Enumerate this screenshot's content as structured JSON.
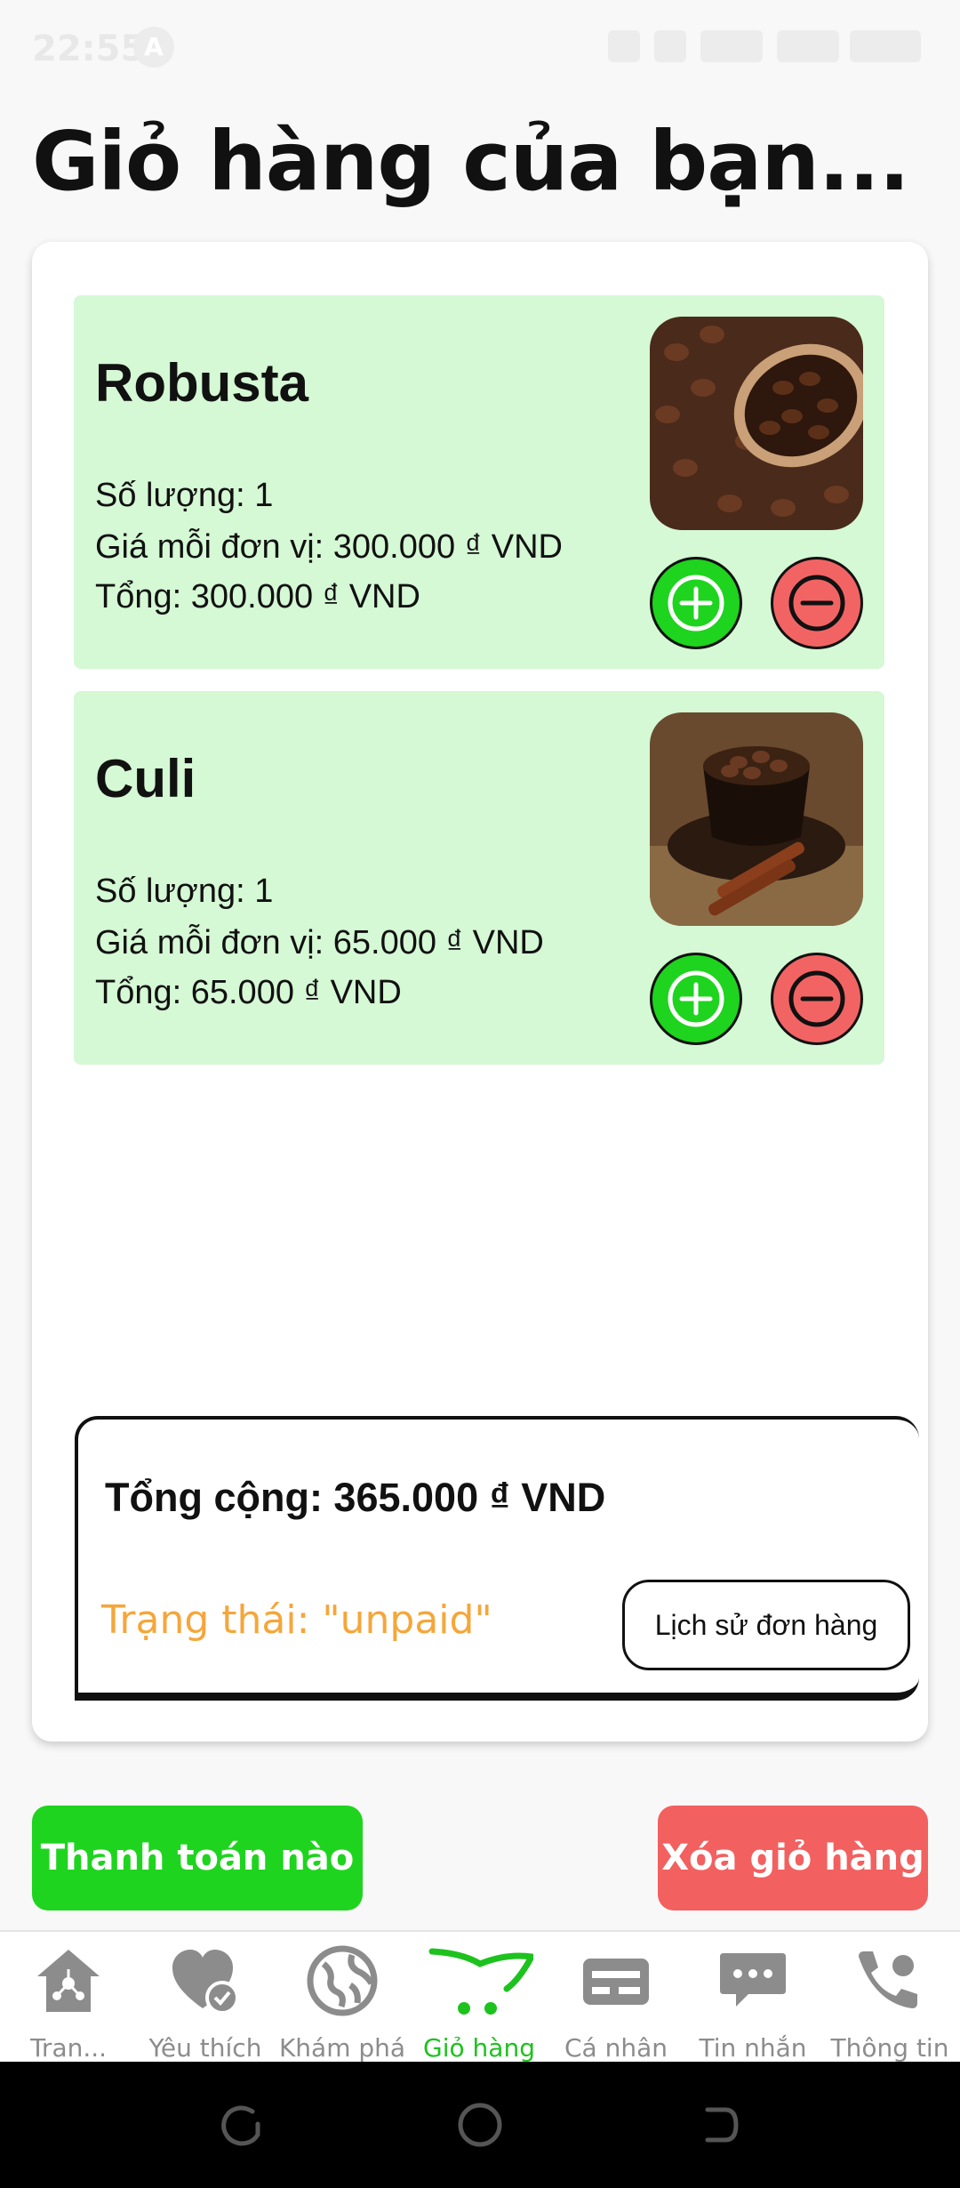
{
  "status_bar": {
    "time": "22:55",
    "badge": "A"
  },
  "page": {
    "title": "Giỏ hàng của bạn..."
  },
  "cart_items": [
    {
      "name": "Robusta",
      "quantity": "Số lượng: 1",
      "unit_price": "Giá mỗi đơn vị: 300.000 ₫ VND",
      "total": "Tổng: 300.000 ₫ VND",
      "photo": "coffee-beans-spoon"
    },
    {
      "name": "Culi",
      "quantity": "Số lượng: 1",
      "unit_price": "Giá mỗi đơn vị: 65.000 ₫ VND",
      "total": "Tổng: 65.000 ₫ VND",
      "photo": "coffee-cup-cinnamon"
    }
  ],
  "summary": {
    "grand_total": "Tổng cộng: 365.000 ₫ VND",
    "status": "Trạng thái: \"unpaid\"",
    "history_label": "Lịch sử đơn hàng"
  },
  "actions": {
    "pay_label": "Thanh toán nào !",
    "clear_label": "Xóa giỏ hàng"
  },
  "bottom_nav": [
    {
      "label": "Tran...",
      "icon": "home-icon"
    },
    {
      "label": "Yêu thích",
      "icon": "heart-check-icon"
    },
    {
      "label": "Khám phá",
      "icon": "globe-icon"
    },
    {
      "label": "Giỏ hàng",
      "icon": "cart-icon",
      "active": true
    },
    {
      "label": "Cá nhân",
      "icon": "card-icon"
    },
    {
      "label": "Tin nhắn",
      "icon": "message-icon"
    },
    {
      "label": "Thông tin",
      "icon": "contact-icon"
    }
  ],
  "colors": {
    "item_bg": "#d5f8d5",
    "accent_green": "#1ed41e",
    "danger_red": "#f26464",
    "status_orange": "#f5a63a"
  }
}
